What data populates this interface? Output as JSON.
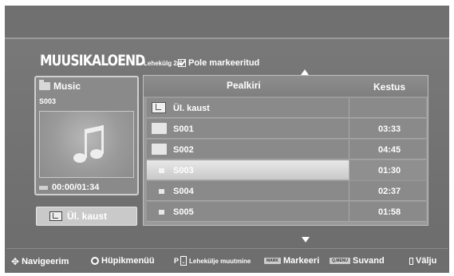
{
  "header": {
    "title": "MUUSIKALOEND",
    "page_info": "Lehekülg 2/3",
    "mark_status": "Pole markeeritud"
  },
  "left_panel": {
    "folder_name": "Music",
    "file_name": "S003",
    "time": "00:00/01:34",
    "parent_button_label": "Ül. kaust"
  },
  "list": {
    "col_title": "Pealkiri",
    "col_duration": "Kestus",
    "rows": [
      {
        "name": "Ül. kaust",
        "duration": "",
        "kind": "parent"
      },
      {
        "name": "S001",
        "duration": "03:33",
        "kind": "folder"
      },
      {
        "name": "S002",
        "duration": "04:45",
        "kind": "folder"
      },
      {
        "name": "S003",
        "duration": "01:30",
        "kind": "file",
        "selected": true
      },
      {
        "name": "S004",
        "duration": "02:37",
        "kind": "file"
      },
      {
        "name": "S005",
        "duration": "01:58",
        "kind": "file"
      }
    ]
  },
  "bottom_bar": {
    "navigate": "Navigeerim",
    "popup_menu": "Hüpikmenüü",
    "page_change": "Lehekülje muutmine",
    "mark_key": "MARK",
    "mark": "Markeeri",
    "option_key": "Q.MENU",
    "option": "Suvand",
    "exit": "Välju"
  },
  "icons": {
    "folder": "folder-icon",
    "music_note": "music-note-icon",
    "up": "arrow-up-icon",
    "down": "arrow-down-icon"
  },
  "colors": {
    "background": "#707070",
    "selected_row": "#e0e0e0",
    "text": "#ffffff"
  }
}
